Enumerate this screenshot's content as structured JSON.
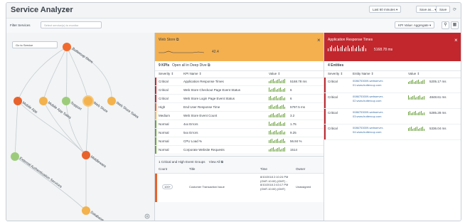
{
  "header": {
    "title": "Service Analyzer",
    "time_range": "Last 60 minutes",
    "save_as": "Save as...",
    "save": "Save"
  },
  "filter": {
    "label": "Filter Services",
    "placeholder": "Select service(s) to monitor",
    "aggregate": "KPI Value: Aggregate"
  },
  "tree": {
    "goto_placeholder": "Go to Service",
    "nodes": [
      {
        "label": "Buttercup Store",
        "color": "#f26b2e"
      },
      {
        "label": "Mobile App",
        "color": "#e8622c"
      },
      {
        "label": "Mobile App Sales",
        "color": "#f3b24d"
      },
      {
        "label": "Support",
        "color": "#9ccc7a"
      },
      {
        "label": "Web Store",
        "color": "#f3b24d"
      },
      {
        "label": "Web Store Sales",
        "color": "#f3b24d"
      },
      {
        "label": "External Authentication Services",
        "color": "#9ccc7a"
      },
      {
        "label": "Middleware",
        "color": "#e8622c"
      },
      {
        "label": "Database",
        "color": "#f3b24d"
      }
    ]
  },
  "webstore": {
    "title": "Web Store",
    "value": "42.4",
    "color": "#f4b04f",
    "kpi_count": "9 KPIs",
    "open_all": "Open all in Deep Dive",
    "columns": [
      "Severity",
      "KPI Name",
      "Value"
    ],
    "rows": [
      {
        "severity": "Critical",
        "name": "Application Response Times",
        "value": "5168.78 ms",
        "sevcolor": "#c1272d"
      },
      {
        "severity": "Critical",
        "name": "Web Store Checkout Page Event Status",
        "value": "6",
        "sevcolor": "#c1272d"
      },
      {
        "severity": "Critical",
        "name": "Web Store Login Page Event Status",
        "value": "6",
        "sevcolor": "#c1272d"
      },
      {
        "severity": "High",
        "name": "End User Response Time",
        "value": "5797.5 ms",
        "sevcolor": "#e8622c"
      },
      {
        "severity": "Medium",
        "name": "Web Store Event Count",
        "value": "3.2",
        "sevcolor": "#f3b24d"
      },
      {
        "severity": "Normal",
        "name": "4xx Errors",
        "value": "1.75",
        "sevcolor": "#6ca23f"
      },
      {
        "severity": "Normal",
        "name": "5xx Errors",
        "value": "9.25",
        "sevcolor": "#6ca23f"
      },
      {
        "severity": "Normal",
        "name": "CPU Load %",
        "value": "56.84 %",
        "sevcolor": "#6ca23f"
      },
      {
        "severity": "Normal",
        "name": "Corporate Website Requests",
        "value": "1514",
        "sevcolor": "#6ca23f"
      }
    ],
    "events_label": "1 Critical and High Event Groups",
    "view_all": "View All",
    "event_columns": [
      "Count",
      "Title",
      "Time",
      "Owner"
    ],
    "event": {
      "count": "100+",
      "title": "Customer Transaction Issue",
      "time": "8/10/2018 2:10:24 PM (GMT-10:00) (GMT) - 8/10/2018 2:43:17 PM (GMT-10:00) (GMT)",
      "owner": "Unassigned"
    }
  },
  "app": {
    "title": "Application Response Times",
    "value": "5168.78 ms",
    "color": "#c1272d",
    "entity_count": "4 Entities",
    "columns": [
      "Severity",
      "Entity Name",
      "Value"
    ],
    "rows": [
      {
        "severity": "Critical",
        "name": "0086753009-webserver-01.www.buttercup.com",
        "value": "5205.17 ms"
      },
      {
        "severity": "Critical",
        "name": "0086753009-webserver-02.www.buttercup.com",
        "value": "4848.61 ms"
      },
      {
        "severity": "Critical",
        "name": "0086753009-webserver-03.www.buttercup.com",
        "value": "5285.28 ms"
      },
      {
        "severity": "Critical",
        "name": "0086753009-webserver-04.www.buttercup.com",
        "value": "5336.04 ms"
      }
    ]
  },
  "icons": {
    "refresh": "refresh-icon",
    "pencil": "pencil-icon",
    "close": "close-icon",
    "layout": "layout-icon",
    "grid": "grid-icon"
  }
}
